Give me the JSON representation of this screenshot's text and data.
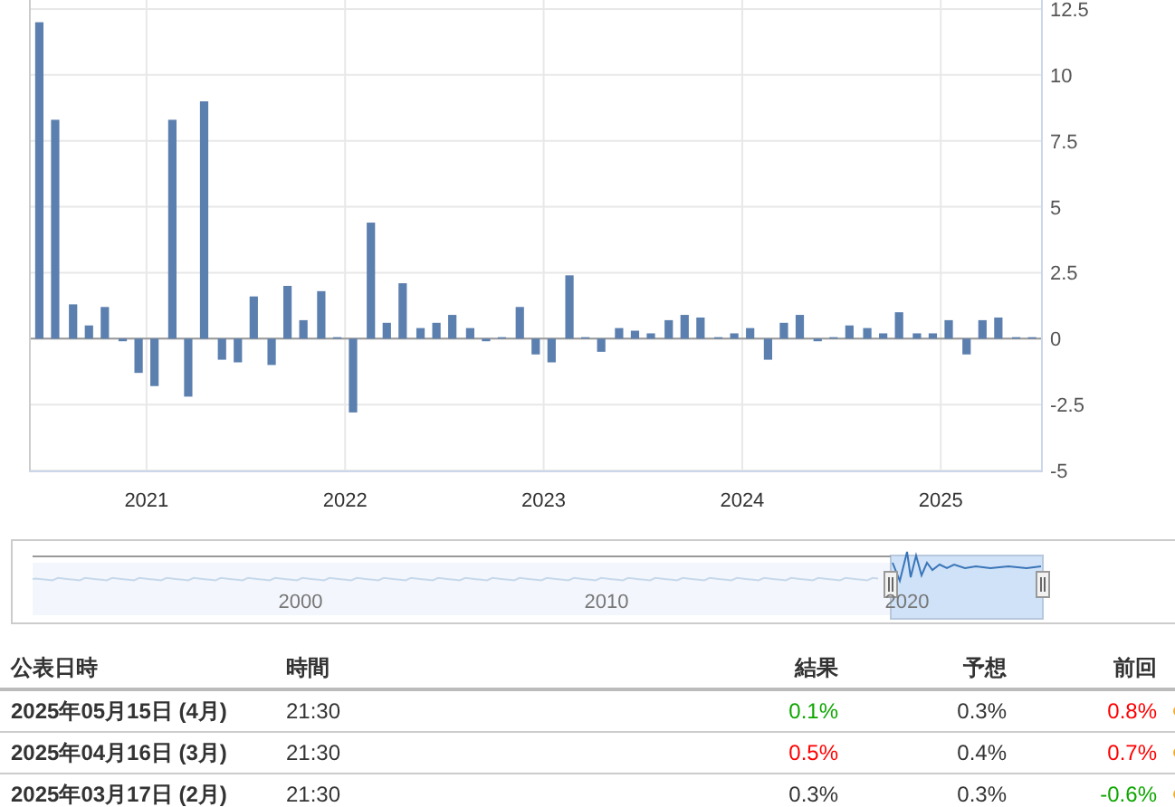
{
  "chart": {
    "chart_data": {
      "type": "bar",
      "x": [
        2020.46,
        2020.54,
        2020.63,
        2020.71,
        2020.79,
        2020.88,
        2020.96,
        2021.04,
        2021.13,
        2021.21,
        2021.29,
        2021.38,
        2021.46,
        2021.54,
        2021.63,
        2021.71,
        2021.79,
        2021.88,
        2021.96,
        2022.04,
        2022.13,
        2022.21,
        2022.29,
        2022.38,
        2022.46,
        2022.54,
        2022.63,
        2022.71,
        2022.79,
        2022.88,
        2022.96,
        2023.04,
        2023.13,
        2023.21,
        2023.29,
        2023.38,
        2023.46,
        2023.54,
        2023.63,
        2023.71,
        2023.79,
        2023.88,
        2023.96,
        2024.04,
        2024.13,
        2024.21,
        2024.29,
        2024.38,
        2024.46,
        2024.54,
        2024.63,
        2024.71,
        2024.79,
        2024.88,
        2024.96,
        2025.04,
        2025.13,
        2025.21,
        2025.29,
        2025.38,
        2025.46
      ],
      "xlim": [
        2020.417,
        2025.505
      ],
      "grid": true,
      "series": [
        {
          "color": "#5b7fae",
          "values": [
            12.0,
            8.3,
            1.3,
            0.5,
            1.2,
            -0.1,
            -1.3,
            -1.8,
            8.3,
            -2.2,
            9.0,
            -0.8,
            -0.9,
            1.6,
            -1.0,
            2.0,
            0.7,
            1.8,
            0.05,
            -2.8,
            4.4,
            0.6,
            2.1,
            0.4,
            0.6,
            0.9,
            0.4,
            -0.1,
            0.05,
            1.2,
            -0.6,
            -0.9,
            2.4,
            0,
            -0.5,
            0.4,
            0.3,
            0.2,
            0.7,
            0.9,
            0.8,
            0,
            0.2,
            0.4,
            -0.8,
            0.6,
            0.9,
            -0.1,
            0.05,
            0.5,
            0.4,
            0.2,
            1.0,
            0.2,
            0.2,
            0.7,
            -0.6,
            0.7,
            0.8,
            0.05,
            0.05
          ]
        }
      ],
      "ylim": [
        -5,
        12.5
      ],
      "yticks": [
        -5,
        -2.5,
        0,
        2.5,
        5,
        7.5,
        10,
        12.5
      ],
      "xticks": [
        2021,
        2022,
        2023,
        2024,
        2025
      ]
    }
  },
  "navigator": {
    "labels": [
      "2000",
      "2010",
      "2020"
    ]
  },
  "table": {
    "columns": [
      "公表日時",
      "時間",
      "結果",
      "予想",
      "前回"
    ],
    "rows": [
      {
        "date": "2025年05月15日 (4月)",
        "time": "21:30",
        "actual": {
          "text": "0.1%",
          "color": "#0ea600"
        },
        "forecast": "0.3%",
        "previous": {
          "text": "0.8%",
          "color": "#ff0000"
        },
        "marker": {
          "color": "#f0ad35"
        }
      },
      {
        "date": "2025年04月16日 (3月)",
        "time": "21:30",
        "actual": {
          "text": "0.5%",
          "color": "#ff0000"
        },
        "forecast": "0.4%",
        "previous": {
          "text": "0.7%",
          "color": "#ff0000"
        },
        "marker": {
          "color": "#f0ad35"
        }
      },
      {
        "date": "2025年03月17日 (2月)",
        "time": "21:30",
        "actual": {
          "text": "0.3%",
          "color": "#333333"
        },
        "forecast": "0.3%",
        "previous": {
          "text": "-0.6%",
          "color": "#0ea600"
        },
        "marker": {
          "color": "#f0ad35"
        }
      }
    ]
  }
}
